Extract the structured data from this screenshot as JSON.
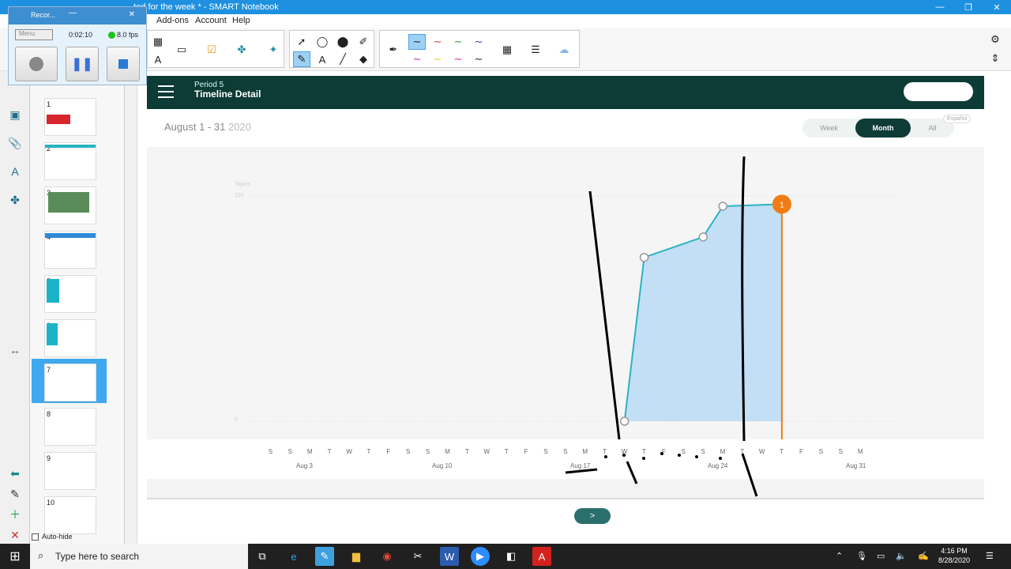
{
  "window": {
    "title": "Hands-On Chart All Topics Completed for the week * - SMART Notebook",
    "title_visible": "...ted for the week * - SMART Notebook",
    "buttons": [
      "—",
      "❐",
      "✕"
    ]
  },
  "menubar": {
    "items": [
      "Add-ons",
      "Account",
      "Help"
    ]
  },
  "recorder": {
    "title": "Recor...",
    "menu_label": "Menu",
    "elapsed": "0:02:10",
    "fps": "8.0 fps",
    "record_color": "#888888",
    "pause_color": "#3a6fd8",
    "stop_color": "#2a79d3"
  },
  "slides": [
    {
      "num": "1"
    },
    {
      "num": "2"
    },
    {
      "num": "3"
    },
    {
      "num": "4"
    },
    {
      "num": "5"
    },
    {
      "num": "6"
    },
    {
      "num": "7"
    },
    {
      "num": "8"
    },
    {
      "num": "9"
    },
    {
      "num": "10"
    }
  ],
  "auto_hide": "Auto-hide",
  "app": {
    "period": "Period 5",
    "page_title": "Timeline Detail",
    "date_range": "August 1 - 31",
    "year": "2020",
    "view_tabs": [
      "Week",
      "Month",
      "All"
    ],
    "active_tab": "Month",
    "language": "Español",
    "header_color": "#0d3b36",
    "accent_color": "#2bb3c0",
    "marker_color": "#f07d14"
  },
  "chart_data": {
    "type": "area",
    "ylabel": "Topics",
    "y_ticks": [
      "110",
      "0"
    ],
    "x_day_labels": [
      "S",
      "S",
      "M",
      "T",
      "W",
      "T",
      "F",
      "S",
      "S",
      "M",
      "T",
      "W",
      "T",
      "F",
      "S",
      "S",
      "M",
      "T",
      "W",
      "T",
      "F",
      "S",
      "S",
      "M",
      "T",
      "W",
      "T",
      "F",
      "S",
      "S",
      "M"
    ],
    "x_week_labels": [
      "Aug 3",
      "Aug 10",
      "Aug 17",
      "Aug 24",
      "Aug 31"
    ],
    "series": [
      {
        "x": [
          "Aug 19",
          "Aug 20",
          "Aug 23",
          "Aug 24",
          "Aug 27"
        ],
        "values": [
          0,
          80,
          90,
          105,
          106
        ]
      }
    ],
    "current_marker": {
      "x": "Aug 27",
      "label": "1"
    }
  },
  "taskbar": {
    "search_placeholder": "Type here to search",
    "time": "4:16 PM",
    "date": "8/28/2020",
    "apps": [
      "task-view",
      "edge",
      "smart-notebook",
      "file-explorer",
      "chrome",
      "snipping",
      "word",
      "zoom",
      "recorder",
      "acrobat"
    ]
  }
}
